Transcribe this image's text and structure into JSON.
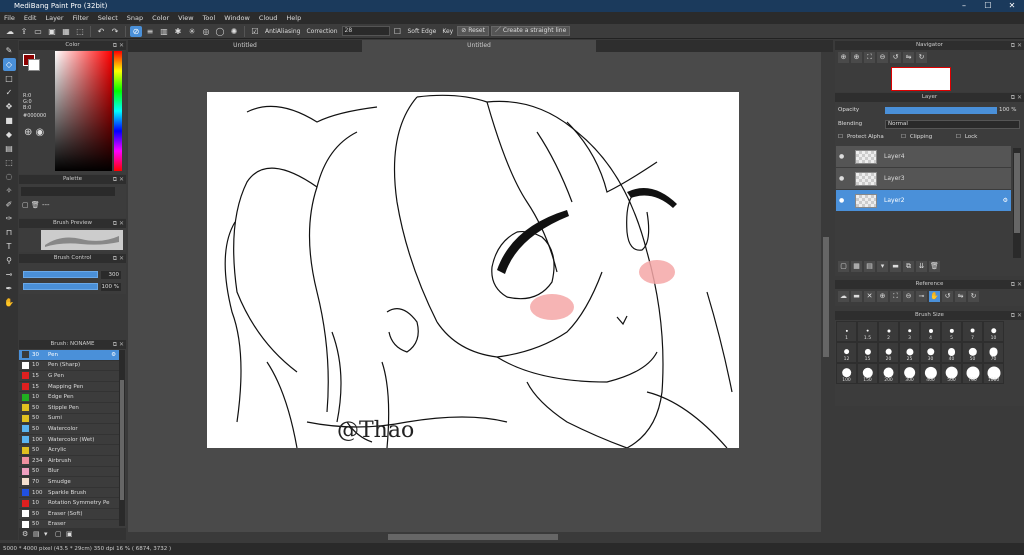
{
  "app": {
    "title": "MediBang Paint Pro (32bit)"
  },
  "menu": [
    "File",
    "Edit",
    "Layer",
    "Filter",
    "Select",
    "Snap",
    "Color",
    "View",
    "Tool",
    "Window",
    "Cloud",
    "Help"
  ],
  "toolbar": {
    "antialias": "AntiAliasing",
    "correction_label": "Correction",
    "correction_value": "28",
    "soft_edge": "Soft Edge",
    "key": "Key",
    "reset": "Reset",
    "straight_line": "Create a straight line"
  },
  "colorPanel": {
    "title": "Color",
    "r": "R:0",
    "g": "G:0",
    "b": "B:0",
    "hex": "#000000"
  },
  "palettePanel": {
    "title": "Palette",
    "text": "---"
  },
  "previewPanel": {
    "title": "Brush Preview"
  },
  "controlPanel": {
    "title": "Brush Control",
    "size": "300",
    "opacity": "100 %"
  },
  "brushPanel": {
    "title": "Brush: NONAME",
    "items": [
      {
        "size": "30",
        "name": "Pen",
        "color": "#3a3a3a"
      },
      {
        "size": "10",
        "name": "Pen (Sharp)",
        "color": "#ffffff"
      },
      {
        "size": "15",
        "name": "G Pen",
        "color": "#e02020"
      },
      {
        "size": "15",
        "name": "Mapping Pen",
        "color": "#e02020"
      },
      {
        "size": "10",
        "name": "Edge Pen",
        "color": "#20b020"
      },
      {
        "size": "50",
        "name": "Stipple Pen",
        "color": "#e0c020"
      },
      {
        "size": "50",
        "name": "Sumi",
        "color": "#e0c020"
      },
      {
        "size": "50",
        "name": "Watercolor",
        "color": "#5ab4f0"
      },
      {
        "size": "100",
        "name": "Watercolor (Wet)",
        "color": "#5ab4f0"
      },
      {
        "size": "50",
        "name": "Acrylic",
        "color": "#e0c020"
      },
      {
        "size": "234",
        "name": "Airbrush",
        "color": "#f090a0"
      },
      {
        "size": "50",
        "name": "Blur",
        "color": "#f0a0c0"
      },
      {
        "size": "70",
        "name": "Smudge",
        "color": "#f5e0d0"
      },
      {
        "size": "100",
        "name": "Sparkle Brush",
        "color": "#2050e0"
      },
      {
        "size": "10",
        "name": "Rotation Symmetry Pe",
        "color": "#e02020"
      },
      {
        "size": "50",
        "name": "Eraser (Soft)",
        "color": "#ffffff"
      },
      {
        "size": "50",
        "name": "Eraser",
        "color": "#ffffff"
      }
    ]
  },
  "tabs": [
    "Untitled",
    "Untitled"
  ],
  "navigator": {
    "title": "Navigator"
  },
  "layerPanel": {
    "title": "Layer",
    "opacity_label": "Opacity",
    "opacity_value": "100 %",
    "blending_label": "Blending",
    "blending_value": "Normal",
    "protect_alpha": "Protect Alpha",
    "clipping": "Clipping",
    "lock": "Lock",
    "layers": [
      {
        "name": "Layer4"
      },
      {
        "name": "Layer3"
      },
      {
        "name": "Layer2",
        "selected": true
      }
    ]
  },
  "referencePanel": {
    "title": "Reference"
  },
  "brushSizePanel": {
    "title": "Brush Size",
    "sizes": [
      "1",
      "1.5",
      "2",
      "3",
      "4",
      "5",
      "7",
      "10",
      "12",
      "15",
      "20",
      "25",
      "30",
      "40",
      "50",
      "70",
      "100",
      "150",
      "200",
      "300",
      "400",
      "500",
      "700",
      "1000"
    ]
  },
  "canvas": {
    "signature": "@Thao"
  },
  "status": {
    "text": "5000 * 4000 pixel  (43.5 * 29cm)  350 dpi  16 %  ( 6874, 3732 )"
  }
}
